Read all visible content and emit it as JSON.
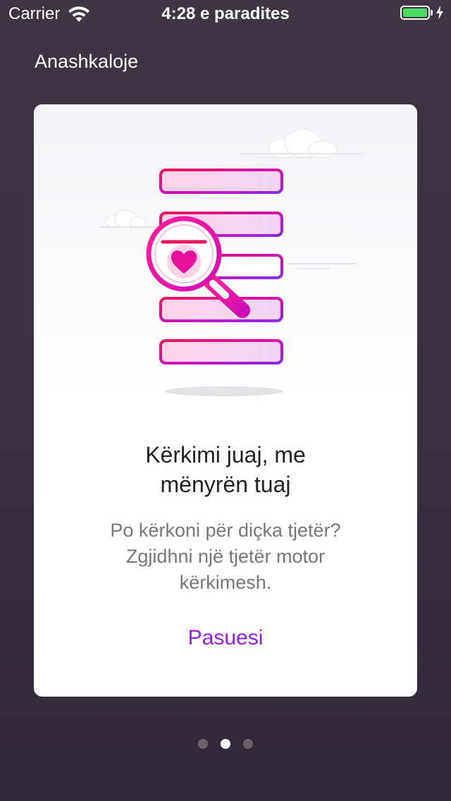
{
  "status_bar": {
    "carrier": "Carrier",
    "time": "4:28 e paradites",
    "battery_color": "#4cd964"
  },
  "header": {
    "skip_label": "Anashkaloje"
  },
  "card": {
    "illustration_icon": "magnifier-heart-list-icon",
    "title_line1": "Kërkimi juaj, me",
    "title_line2": "mënyrën tuaj",
    "body_line1": "Po kërkoni për diçka tjetër?",
    "body_line2": "Zgjidhni një tjetër motor",
    "body_line3": "kërkimesh.",
    "next_label": "Pasuesi",
    "accent_color": "#9a1cf0",
    "gradient_start": "#e8175d",
    "gradient_end": "#8a2be2"
  },
  "pager": {
    "count": 3,
    "active_index": 1
  }
}
